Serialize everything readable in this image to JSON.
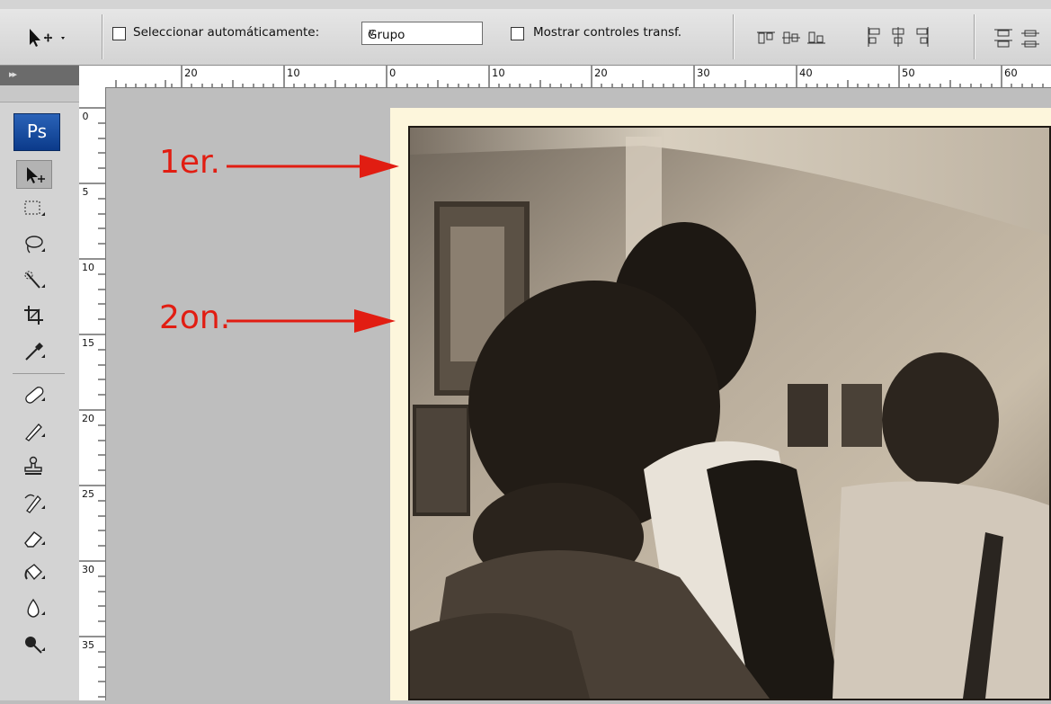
{
  "options_bar": {
    "auto_select": {
      "label": "Seleccionar automáticamente:",
      "checked": false
    },
    "auto_select_mode": {
      "value": "Grupo"
    },
    "show_transform": {
      "label": "Mostrar controles transf.",
      "checked": false
    }
  },
  "toolbox": {
    "app_logo": "Ps",
    "tools": [
      "move-tool-icon",
      "marquee-tool-icon",
      "lasso-tool-icon",
      "quick-selection-tool-icon",
      "crop-tool-icon",
      "eyedropper-tool-icon",
      "healing-brush-icon",
      "brush-tool-icon",
      "clone-stamp-icon",
      "history-brush-icon",
      "eraser-tool-icon",
      "paint-bucket-icon",
      "blur-tool-icon",
      "dodge-tool-icon"
    ]
  },
  "ruler_top": {
    "labels": [
      "20",
      "10",
      "0",
      "10",
      "20",
      "30",
      "40",
      "50",
      "60"
    ]
  },
  "ruler_left": {
    "labels": [
      "0",
      "5",
      "10",
      "15",
      "20",
      "25",
      "30",
      "35"
    ]
  },
  "annotations": [
    {
      "text": "1er."
    },
    {
      "text": "2on."
    }
  ],
  "colors": {
    "annotation": "#e11d12",
    "canvas": "#bebebe",
    "paper": "#fdf6dc"
  }
}
